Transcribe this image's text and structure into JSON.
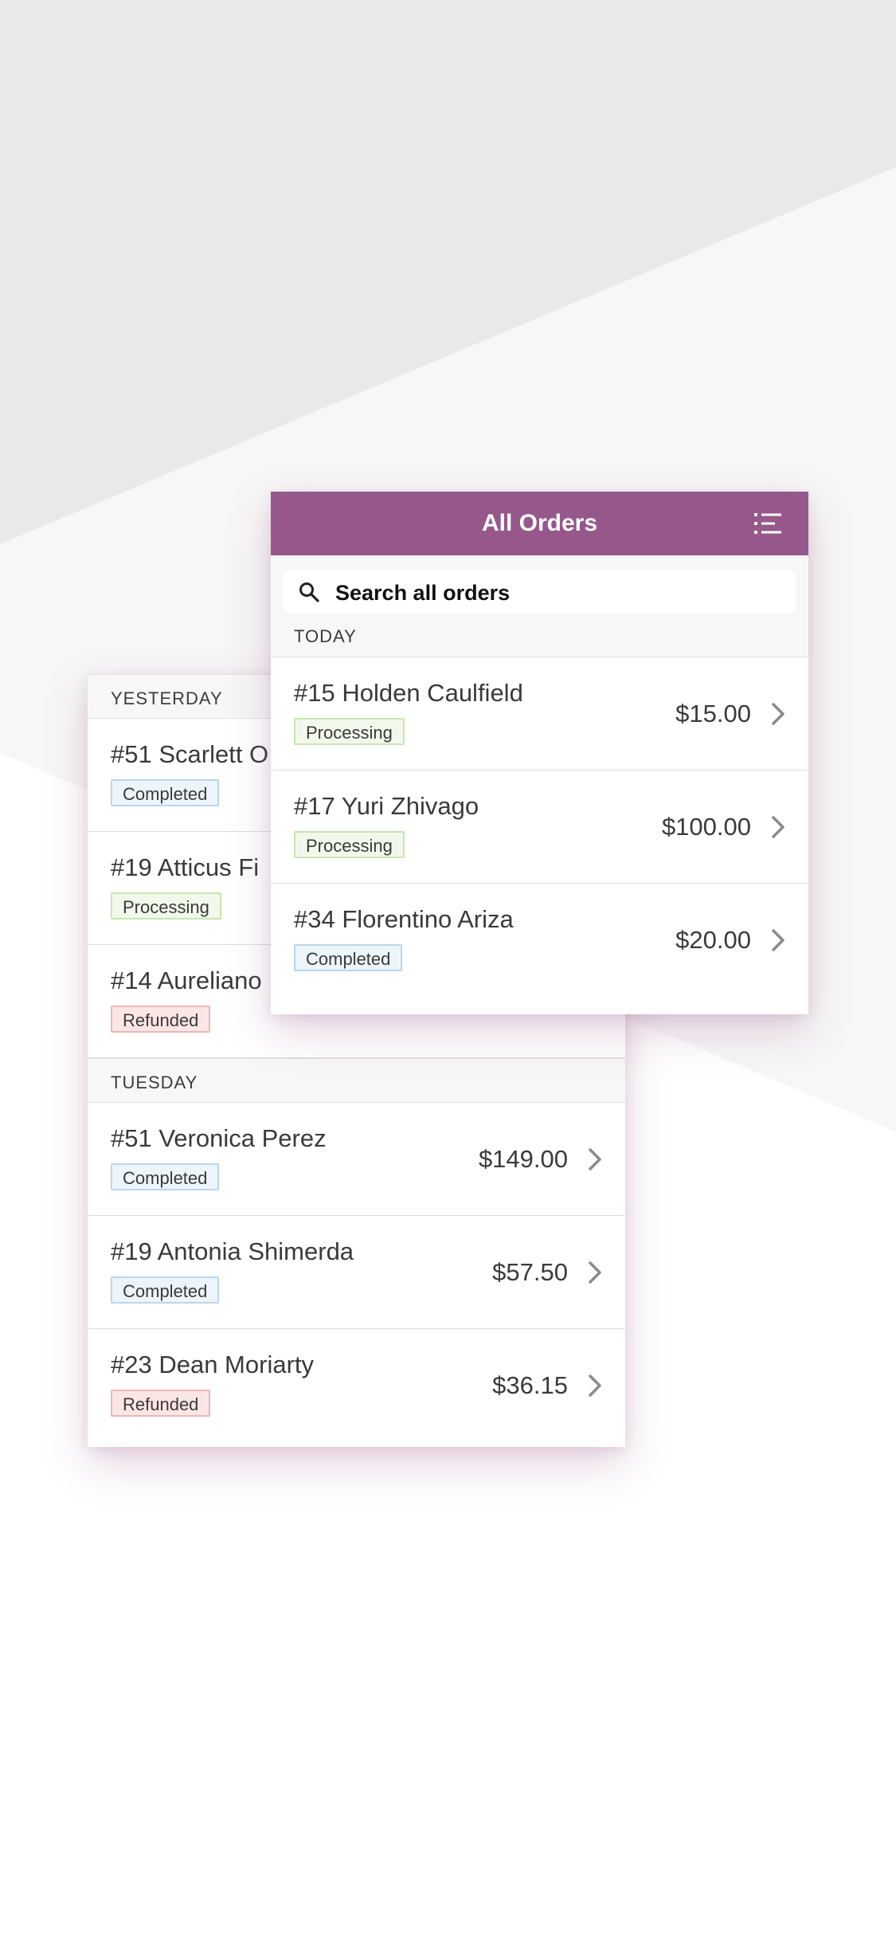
{
  "colors": {
    "header": "#96588a",
    "completed_bg": "#edf5fb",
    "processing_bg": "#f2f9ec",
    "refunded_bg": "#fbe6e5"
  },
  "back_card": {
    "sections": [
      {
        "label": "YESTERDAY",
        "orders": [
          {
            "name": "#51 Scarlett O",
            "status": "Completed",
            "amount": ""
          },
          {
            "name": "#19 Atticus Fi",
            "status": "Processing",
            "amount": ""
          },
          {
            "name": "#14 Aureliano",
            "status": "Refunded",
            "amount": ""
          }
        ]
      },
      {
        "label": "TUESDAY",
        "orders": [
          {
            "name": "#51 Veronica Perez",
            "status": "Completed",
            "amount": "$149.00"
          },
          {
            "name": "#19 Antonia Shimerda",
            "status": "Completed",
            "amount": "$57.50"
          },
          {
            "name": "#23 Dean Moriarty",
            "status": "Refunded",
            "amount": "$36.15"
          }
        ]
      }
    ]
  },
  "front_card": {
    "title": "All Orders",
    "menu_icon": "list-filter-icon",
    "search": {
      "label": "Search all orders",
      "icon": "search-icon"
    },
    "section": {
      "label": "TODAY"
    },
    "orders": [
      {
        "name": "#15 Holden Caulfield",
        "status": "Processing",
        "amount": "$15.00"
      },
      {
        "name": "#17 Yuri Zhivago",
        "status": "Processing",
        "amount": "$100.00"
      },
      {
        "name": "#34 Florentino Ariza",
        "status": "Completed",
        "amount": "$20.00"
      }
    ]
  }
}
